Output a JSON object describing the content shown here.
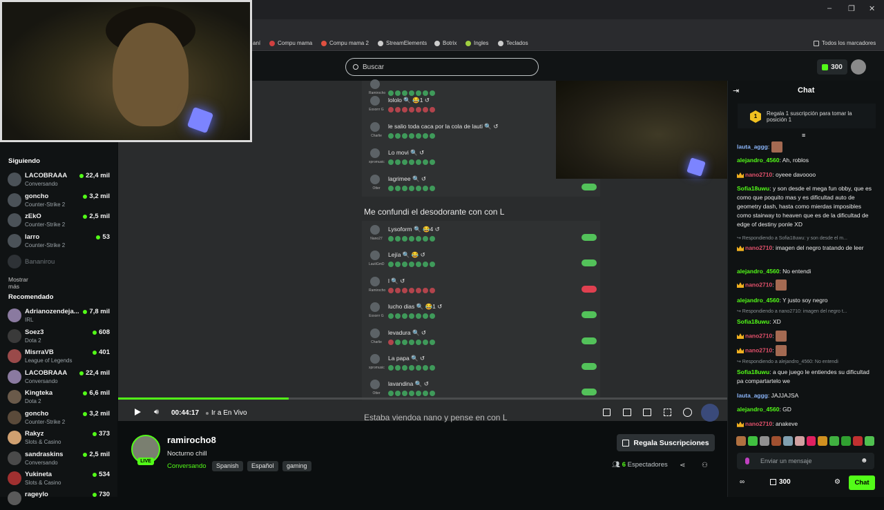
{
  "browser": {
    "bookmarks": [
      {
        "label": "aní",
        "color": "#d04040"
      },
      {
        "label": "Compu mama",
        "color": "#d04040"
      },
      {
        "label": "Compu mama 2",
        "color": "#e05040"
      },
      {
        "label": "StreamElements",
        "color": "#cccccc"
      },
      {
        "label": "Botrix",
        "color": "#cccccc"
      },
      {
        "label": "Ingles",
        "color": "#a0d040"
      },
      {
        "label": "Teclados",
        "color": "#cccccc"
      }
    ],
    "all_bookmarks": "Todos los marcadores",
    "window_controls": [
      "–",
      "❐",
      "✕"
    ]
  },
  "header": {
    "search_placeholder": "Buscar",
    "points": "300"
  },
  "sidebar": {
    "following_title": "Siguiendo",
    "following": [
      {
        "name": "LACOBRAAA",
        "category": "Conversando",
        "viewers": "22,4 mil",
        "live": true
      },
      {
        "name": "goncho",
        "category": "Counter-Strike 2",
        "viewers": "3,2 mil",
        "live": true
      },
      {
        "name": "zEkO",
        "category": "Counter-Strike 2",
        "viewers": "2,5 mil",
        "live": true
      },
      {
        "name": "larro",
        "category": "Counter-Strike 2",
        "viewers": "53",
        "live": true
      },
      {
        "name": "Bananirou",
        "category": "",
        "viewers": "",
        "live": false
      }
    ],
    "show_more": "Mostrar más",
    "recommended_title": "Recomendado",
    "recommended": [
      {
        "name": "Adrianozendeja...",
        "category": "IRL",
        "viewers": "7,8 mil"
      },
      {
        "name": "Soez3",
        "category": "Dota 2",
        "viewers": "608"
      },
      {
        "name": "MisrraVB",
        "category": "League of Legends",
        "viewers": "401"
      },
      {
        "name": "LACOBRAAA",
        "category": "Conversando",
        "viewers": "22,4 mil"
      },
      {
        "name": "Kingteka",
        "category": "Dota 2",
        "viewers": "6,6 mil"
      },
      {
        "name": "goncho",
        "category": "Counter-Strike 2",
        "viewers": "3,2 mil"
      },
      {
        "name": "Rakyz",
        "category": "Slots & Casino",
        "viewers": "373"
      },
      {
        "name": "sandraskins",
        "category": "Conversando",
        "viewers": "2,5 mil"
      },
      {
        "name": "Yukineta",
        "category": "Slots & Casino",
        "viewers": "534"
      },
      {
        "name": "rageylo",
        "category": "",
        "viewers": "730"
      }
    ]
  },
  "video": {
    "poll_top": [
      {
        "user": "Ramirocho",
        "text": "",
        "dots": "green",
        "toggle": ""
      },
      {
        "user": "Exxorrr G",
        "text": "lololo 🔍 😂1 ↺",
        "dots": "red",
        "toggle": ""
      },
      {
        "user": "Charlie",
        "text": "le salio toda caca por la cola de lauti 🔍 ↺",
        "dots": "green",
        "toggle": ""
      },
      {
        "user": "xpromusic",
        "text": "Lo movi 🔍 ↺",
        "dots": "green",
        "toggle": ""
      },
      {
        "user": "Otter",
        "text": "lagrimee 🔍 ↺",
        "dots": "green",
        "toggle": "on"
      }
    ],
    "caption": "Me confundi el desodorante con con L",
    "poll_bottom": [
      {
        "user": "Nano27",
        "text": "Lysoform 🔍 😂4 ↺",
        "dots": "green",
        "toggle": "on"
      },
      {
        "user": "LautiGmD",
        "text": "Lejía 🔍 😂 ↺",
        "dots": "green",
        "toggle": "on"
      },
      {
        "user": "Ramirocho",
        "text": "l 🔍 ↺",
        "dots": "red",
        "toggle": "off"
      },
      {
        "user": "Exxorrr G",
        "text": "lucho dias 🔍 😂1 ↺",
        "dots": "green",
        "toggle": "on"
      },
      {
        "user": "Charlie",
        "text": "levadura 🔍 ↺",
        "dots": "mixed",
        "toggle": "on"
      },
      {
        "user": "xpromusic",
        "text": "La papa 🔍 ↺",
        "dots": "green",
        "toggle": "on"
      },
      {
        "user": "Otter",
        "text": "lavandina 🔍 ↺",
        "dots": "green",
        "toggle": "on"
      }
    ],
    "caption_2": "Estaba viendoa nano y pense en con L",
    "progress": 0.28,
    "time": "00:44:17",
    "go_live": "Ir a En Vivo"
  },
  "stream": {
    "streamer": "ramirocho8",
    "title": "Nocturno chill",
    "live_badge": "LIVE",
    "category": "Conversando",
    "tags": [
      "Spanish",
      "Español",
      "gaming"
    ],
    "gift_label": "Regala Suscripciones",
    "viewers_count": "6",
    "viewers_label": "Espectadores"
  },
  "chat": {
    "title": "Chat",
    "banner_rank": "1",
    "banner_text": "Regala 1 suscripción para tomar la posición 1",
    "messages": [
      {
        "user": "lauta_aggg",
        "color": "#8ab4f8",
        "text": "",
        "emote": true,
        "crown": false
      },
      {
        "user": "alejandro_4560",
        "color": "#53fc18",
        "text": "Ah, roblos",
        "emote": false,
        "crown": false
      },
      {
        "user": "nano2710",
        "color": "#e0506a",
        "text": "oyeee davoooo",
        "emote": false,
        "crown": true
      },
      {
        "user": "Sofia18uwu",
        "color": "#53fc18",
        "text": "y son desde el mega fun obby, que es como que poquito mas y es dificultad auto de geometry dash, hasta como mierdas imposibles como stairway to heaven que es de la dificultad de edge of destiny ponle XD",
        "emote": false,
        "crown": false
      },
      {
        "reply": "Respondiendo a Sofia18uwu: y son desde el m..."
      },
      {
        "user": "nano2710",
        "color": "#e0506a",
        "text": "imagen del negro tratando de leer",
        "emote": false,
        "crown": true
      },
      {
        "user": "alejandro_4560",
        "color": "#53fc18",
        "text": "No entendi",
        "emote": false,
        "crown": false
      },
      {
        "user": "nano2710",
        "color": "#e0506a",
        "text": "",
        "emote": true,
        "crown": true
      },
      {
        "user": "alejandro_4560",
        "color": "#53fc18",
        "text": "Y justo soy negro",
        "emote": false,
        "crown": false
      },
      {
        "reply": "Respondiendo a nano2710: imagen del negro t..."
      },
      {
        "user": "Sofia18uwu",
        "color": "#53fc18",
        "text": "XD",
        "emote": false,
        "crown": false
      },
      {
        "user": "nano2710",
        "color": "#e0506a",
        "text": "",
        "emote": true,
        "crown": true
      },
      {
        "user": "nano2710",
        "color": "#e0506a",
        "text": "",
        "emote": true,
        "crown": true
      },
      {
        "reply": "Respondiendo a alejandro_4560: No entendi"
      },
      {
        "user": "Sofia18uwu",
        "color": "#53fc18",
        "text": "a que juego le entiendes su dificultad pa compartartelo we",
        "emote": false,
        "crown": false
      },
      {
        "user": "lauta_aggg",
        "color": "#8ab4f8",
        "text": "JAJJAJSA",
        "emote": false,
        "crown": false
      },
      {
        "user": "alejandro_4560",
        "color": "#53fc18",
        "text": "GD",
        "emote": false,
        "crown": false
      },
      {
        "user": "nano2710",
        "color": "#e0506a",
        "text": "anakeve",
        "emote": false,
        "crown": true
      }
    ],
    "input_placeholder": "Enviar un mensaje",
    "points": "300",
    "send_label": "Chat",
    "emote_colors": [
      "#b07040",
      "#40c040",
      "#909090",
      "#a05030",
      "#80a0b0",
      "#d0a0a0",
      "#e02060",
      "#d09020",
      "#40b040",
      "#30a030",
      "#c03030",
      "#50c050"
    ]
  },
  "colors": {
    "accent": "#53fc18",
    "background": "#0b0e0f"
  }
}
